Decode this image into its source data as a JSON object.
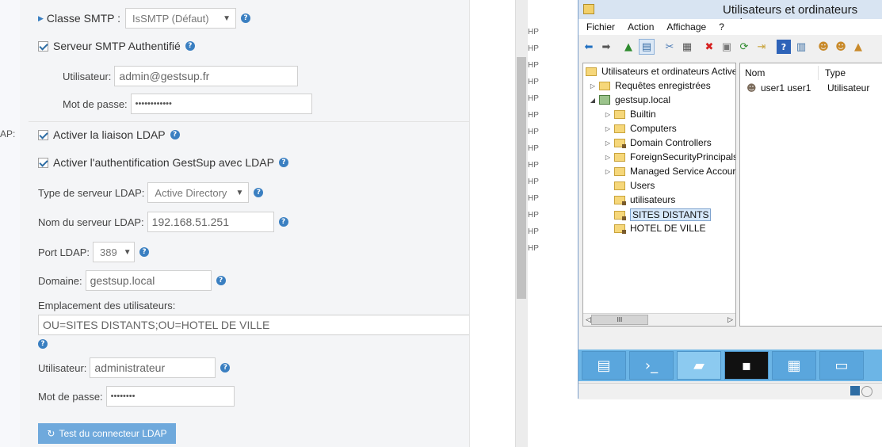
{
  "web": {
    "ldap_cut_label": "AP:",
    "smtp_class": {
      "label": "Classe SMTP :",
      "value": "IsSMTP (Défaut)"
    },
    "smtp_auth": {
      "label": "Serveur SMTP Authentifié"
    },
    "smtp_user": {
      "label": "Utilisateur:",
      "value": "admin@gestsup.fr"
    },
    "smtp_pass": {
      "label": "Mot de passe:",
      "value": "••••••••••••"
    },
    "ldap_enable": {
      "label": "Activer la liaison LDAP"
    },
    "ldap_auth": {
      "label": "Activer l'authentification GestSup avec LDAP"
    },
    "ldap_type": {
      "label": "Type de serveur LDAP:",
      "value": "Active Directory"
    },
    "ldap_server": {
      "label": "Nom du serveur LDAP:",
      "value": "192.168.51.251"
    },
    "ldap_port": {
      "label": "Port LDAP:",
      "value": "389"
    },
    "ldap_domain": {
      "label": "Domaine:",
      "value": "gestsup.local"
    },
    "ldap_location": {
      "label": "Emplacement des utilisateurs:",
      "value": "OU=SITES DISTANTS;OU=HOTEL DE VILLE"
    },
    "ldap_user": {
      "label": "Utilisateur:",
      "value": "administrateur"
    },
    "ldap_pass": {
      "label": "Mot de passe:",
      "value": "••••••••"
    },
    "test_button": "Test du connecteur LDAP",
    "hp_labels": [
      "HP",
      "HP",
      "HP",
      "HP",
      "HP",
      "HP",
      "HP",
      "HP",
      "HP",
      "HP",
      "HP",
      "HP",
      "HP",
      "HP",
      "HP"
    ]
  },
  "window": {
    "title": "Utilisateurs et ordinateurs Activ",
    "menu": [
      "Fichier",
      "Action",
      "Affichage",
      "?"
    ],
    "tree": {
      "root": "Utilisateurs et ordinateurs Active",
      "saved_queries": "Requêtes enregistrées",
      "domain": "gestsup.local",
      "children": [
        "Builtin",
        "Computers",
        "Domain Controllers",
        "ForeignSecurityPrincipals",
        "Managed Service Accour",
        "Users",
        "utilisateurs",
        "SITES DISTANTS",
        "HOTEL DE VILLE"
      ]
    },
    "list": {
      "columns": [
        "Nom",
        "Type"
      ],
      "rows": [
        {
          "name": "user1 user1",
          "type": "Utilisateur"
        }
      ]
    },
    "scroll_thumb": "III"
  }
}
